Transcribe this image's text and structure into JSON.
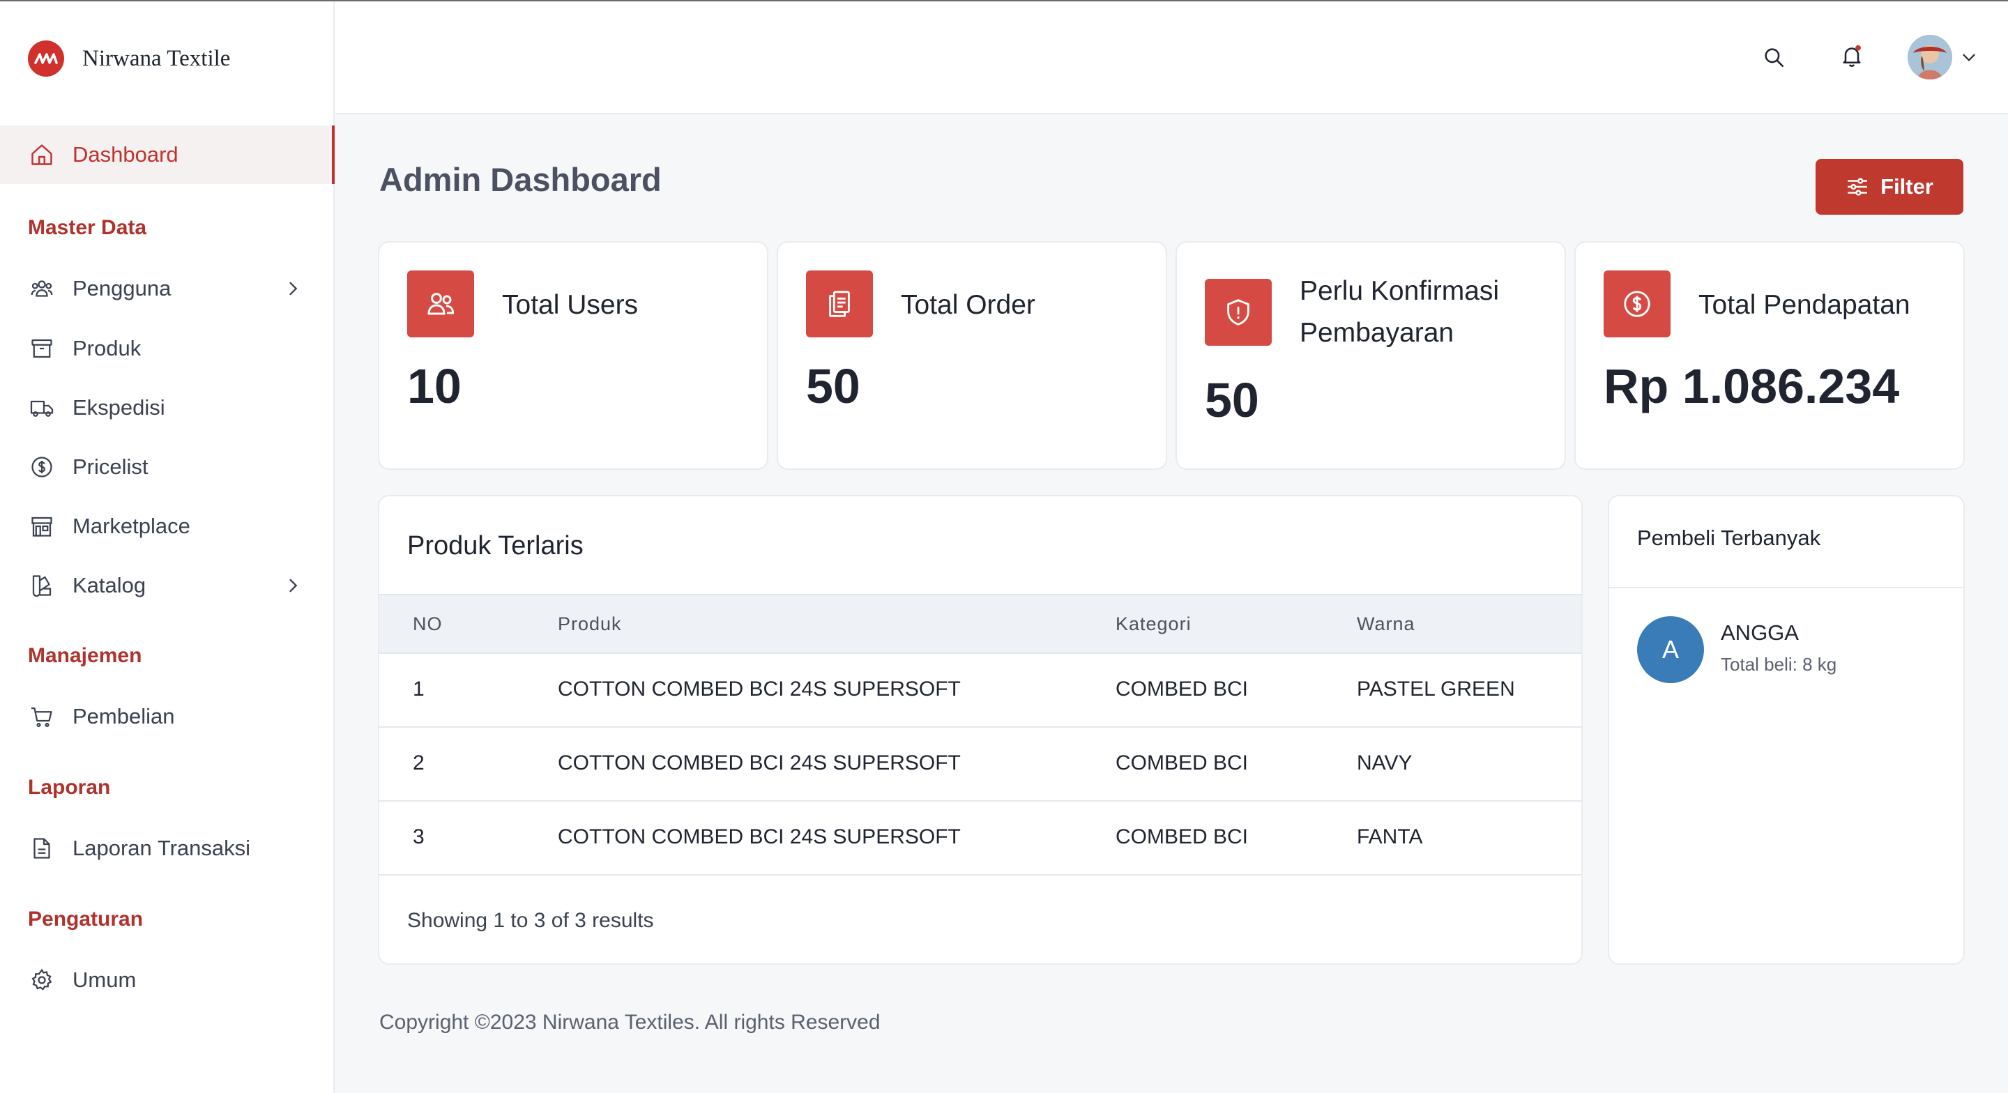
{
  "brand": {
    "name": "Nirwana Textile",
    "logo_icon": "wave-logo-icon",
    "accent": "#c0312c"
  },
  "sidebar": {
    "dashboard": "Dashboard",
    "sections": {
      "master_data": "Master Data",
      "manajemen": "Manajemen",
      "laporan": "Laporan",
      "pengaturan": "Pengaturan"
    },
    "items": {
      "pengguna": "Pengguna",
      "produk": "Produk",
      "ekspedisi": "Ekspedisi",
      "pricelist": "Pricelist",
      "marketplace": "Marketplace",
      "katalog": "Katalog",
      "pembelian": "Pembelian",
      "laporan_transaksi": "Laporan Transaksi",
      "umum": "Umum"
    }
  },
  "header": {
    "icons": [
      "search-icon",
      "bell-icon",
      "avatar",
      "chevron-down-icon"
    ]
  },
  "main": {
    "title": "Admin Dashboard",
    "filter_label": "Filter"
  },
  "stats": {
    "users": {
      "label": "Total Users",
      "value": "10"
    },
    "orders": {
      "label": "Total Order",
      "value": "50"
    },
    "konfirmasi": {
      "label_line1": "Perlu Konfirmasi",
      "label_line2": "Pembayaran",
      "value": "50"
    },
    "pendapatan": {
      "label": "Total Pendapatan",
      "value": "Rp 1.086.234"
    }
  },
  "produk_terlaris": {
    "title": "Produk Terlaris",
    "columns": {
      "no": "NO",
      "produk": "Produk",
      "kategori": "Kategori",
      "warna": "Warna"
    },
    "rows": [
      {
        "no": "1",
        "produk": "COTTON COMBED BCI 24S SUPERSOFT",
        "kategori": "COMBED BCI",
        "warna": "PASTEL GREEN"
      },
      {
        "no": "2",
        "produk": "COTTON COMBED BCI 24S SUPERSOFT",
        "kategori": "COMBED BCI",
        "warna": "NAVY"
      },
      {
        "no": "3",
        "produk": "COTTON COMBED BCI 24S SUPERSOFT",
        "kategori": "COMBED BCI",
        "warna": "FANTA"
      }
    ],
    "showing": "Showing 1 to 3 of 3 results"
  },
  "pembeli": {
    "title": "Pembeli Terbanyak",
    "initial": "A",
    "name": "ANGGA",
    "sub": "Total beli: 8 kg"
  },
  "footer": "Copyright ©2023 Nirwana Textiles. All rights Reserved"
}
